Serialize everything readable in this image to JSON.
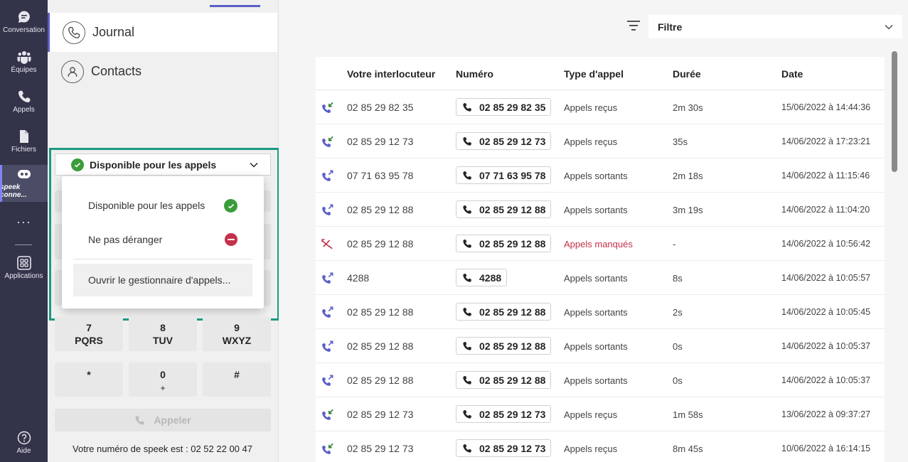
{
  "rail": {
    "items": [
      {
        "label": "Conversation",
        "icon": "chat-icon"
      },
      {
        "label": "Équipes",
        "icon": "teams-icon"
      },
      {
        "label": "Appels",
        "icon": "phone-icon"
      },
      {
        "label": "Fichiers",
        "icon": "file-icon"
      },
      {
        "label": "speek conne...",
        "icon": "speek-app-icon"
      },
      {
        "label": "Applications",
        "icon": "apps-icon"
      },
      {
        "label": "Aide",
        "icon": "help-icon"
      }
    ],
    "more": "···"
  },
  "nav": {
    "journal": "Journal",
    "contacts": "Contacts"
  },
  "status": {
    "selected": "Disponible pour les appels",
    "menu": {
      "available": "Disponible pour les appels",
      "dnd": "Ne pas déranger",
      "open_manager": "Ouvrir le gestionnaire d'appels..."
    }
  },
  "dialpad": {
    "keys": [
      {
        "num": "7",
        "letters": "PQRS"
      },
      {
        "num": "8",
        "letters": "TUV"
      },
      {
        "num": "9",
        "letters": "WXYZ"
      },
      {
        "num": "*",
        "letters": ""
      },
      {
        "num": "0",
        "letters": "+"
      },
      {
        "num": "#",
        "letters": ""
      }
    ],
    "call_label": "Appeler",
    "footer": "Votre numéro de speek est : 02 52 22 00 47"
  },
  "filter": {
    "label": "Filtre"
  },
  "table": {
    "headers": {
      "who": "Votre interlocuteur",
      "number": "Numéro",
      "type": "Type d'appel",
      "duration": "Durée",
      "date": "Date"
    },
    "rows": [
      {
        "direction": "in",
        "who": "02 85 29 82 35",
        "number": "02 85 29 82 35",
        "type": "Appels reçus",
        "duration": "2m 30s",
        "date": "15/06/2022 à 14:44:36"
      },
      {
        "direction": "in",
        "who": "02 85 29 12 73",
        "number": "02 85 29 12 73",
        "type": "Appels reçus",
        "duration": "35s",
        "date": "14/06/2022 à 17:23:21"
      },
      {
        "direction": "out",
        "who": "07 71 63 95 78",
        "number": "07 71 63 95 78",
        "type": "Appels sortants",
        "duration": "2m 18s",
        "date": "14/06/2022 à 11:15:46"
      },
      {
        "direction": "out",
        "who": "02 85 29 12 88",
        "number": "02 85 29 12 88",
        "type": "Appels sortants",
        "duration": "3m 19s",
        "date": "14/06/2022 à 11:04:20"
      },
      {
        "direction": "missed",
        "who": "02 85 29 12 88",
        "number": "02 85 29 12 88",
        "type": "Appels manqués",
        "duration": "-",
        "date": "14/06/2022 à 10:56:42"
      },
      {
        "direction": "out",
        "who": "4288",
        "number": "4288",
        "type": "Appels sortants",
        "duration": "8s",
        "date": "14/06/2022 à 10:05:57"
      },
      {
        "direction": "out",
        "who": "02 85 29 12 88",
        "number": "02 85 29 12 88",
        "type": "Appels sortants",
        "duration": "2s",
        "date": "14/06/2022 à 10:05:45"
      },
      {
        "direction": "out",
        "who": "02 85 29 12 88",
        "number": "02 85 29 12 88",
        "type": "Appels sortants",
        "duration": "0s",
        "date": "14/06/2022 à 10:05:37"
      },
      {
        "direction": "out",
        "who": "02 85 29 12 88",
        "number": "02 85 29 12 88",
        "type": "Appels sortants",
        "duration": "0s",
        "date": "14/06/2022 à 10:05:37"
      },
      {
        "direction": "in",
        "who": "02 85 29 12 73",
        "number": "02 85 29 12 73",
        "type": "Appels reçus",
        "duration": "1m 58s",
        "date": "13/06/2022 à 09:37:27"
      },
      {
        "direction": "in",
        "who": "02 85 29 12 73",
        "number": "02 85 29 12 73",
        "type": "Appels reçus",
        "duration": "8m 45s",
        "date": "10/06/2022 à 16:14:15"
      }
    ]
  },
  "colors": {
    "rail": "#33344a",
    "accent": "#5b5fc7",
    "highlight_frame": "#1a9a82",
    "available": "#3a9d3a",
    "dnd": "#c4314b",
    "incoming": "#2e7d32",
    "outgoing": "#5b5fc7",
    "missed": "#c4314b"
  }
}
